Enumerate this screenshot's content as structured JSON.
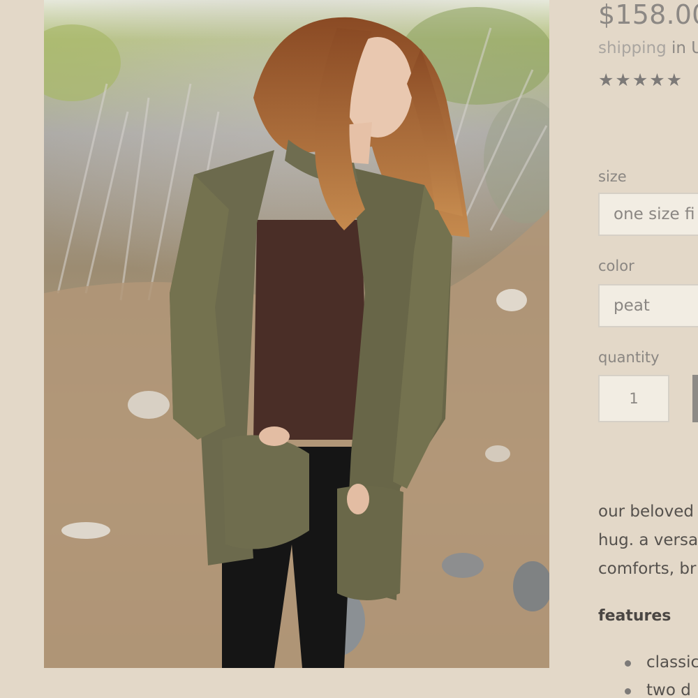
{
  "product": {
    "price": "$158.00",
    "shipping_link": "shipping",
    "shipping_rest": " in U",
    "rating_stars": "★★★★★",
    "rating_value": 5
  },
  "photo": {
    "subject": "model in olive green ruffle-edged cardigan over brown top and black leggings on a rocky hillside path"
  },
  "form": {
    "size": {
      "label": "size",
      "value": "one size fi"
    },
    "color": {
      "label": "color",
      "value": "peat"
    },
    "quantity": {
      "label": "quantity",
      "value": "1"
    }
  },
  "description": {
    "lines": [
      "our beloved",
      "hug. a versa",
      "comforts, br"
    ]
  },
  "features": {
    "heading": "features",
    "items": [
      "classic",
      "two d"
    ]
  },
  "colors": {
    "background": "#e3d8c8",
    "field_bg": "#f2ede3",
    "price_text": "#8c8884",
    "body_text": "#55514d",
    "button": "#8d8a86"
  }
}
